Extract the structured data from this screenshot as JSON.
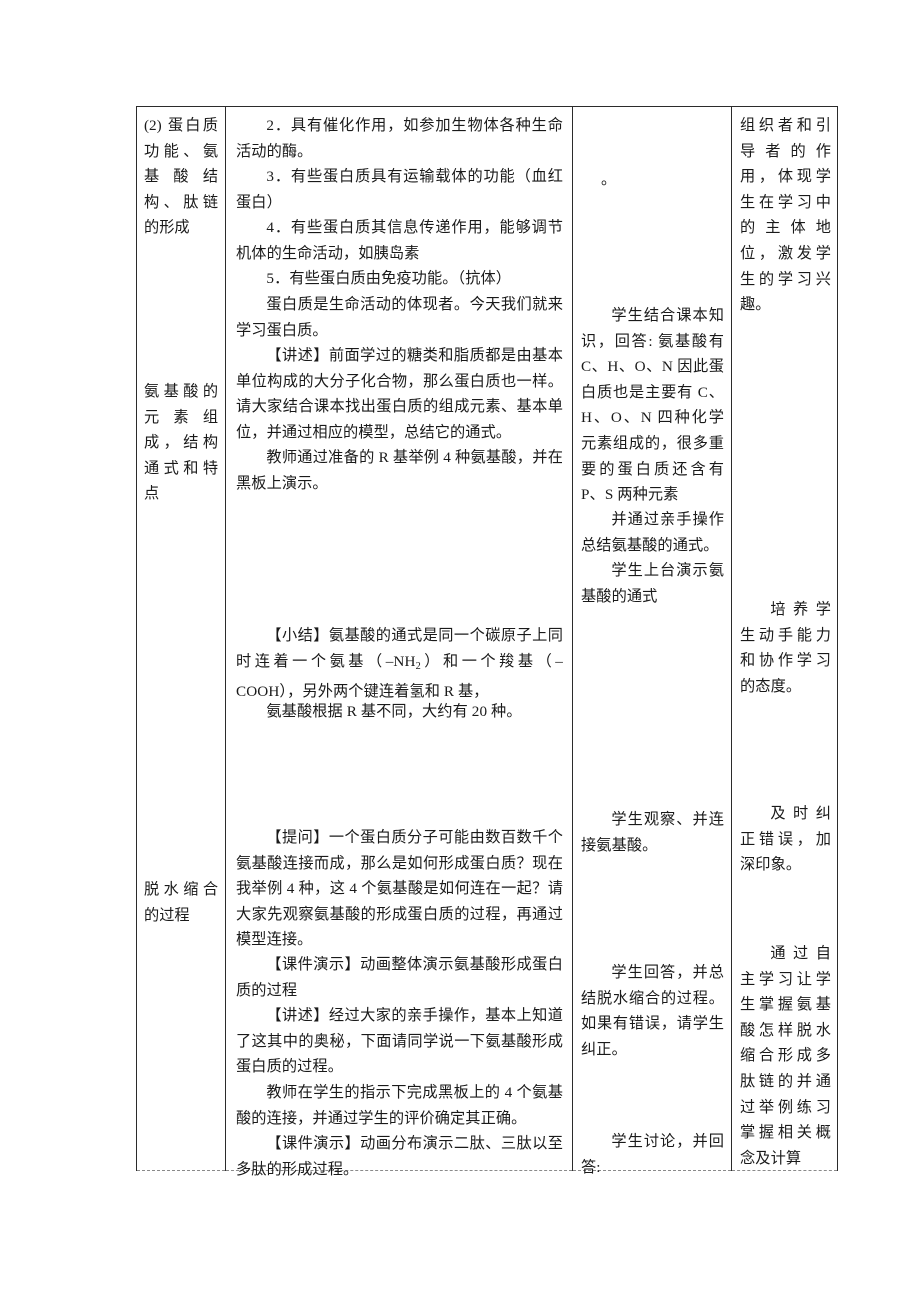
{
  "document": {
    "type": "lesson-plan-table",
    "page_background": "#ffffff",
    "border_color": "#2b2b2b",
    "bottom_border_style": "dashed"
  },
  "columns": [
    {
      "key": "stage",
      "name": "teaching-stage-column"
    },
    {
      "key": "teacher",
      "name": "teacher-activity-column"
    },
    {
      "key": "student",
      "name": "student-activity-column"
    },
    {
      "key": "intent",
      "name": "design-intent-column"
    }
  ],
  "stage_column": {
    "items": [
      {
        "id": "stage-1",
        "text": "(2) 蛋白质功能、氨基酸结构、肽链的形成"
      },
      {
        "id": "stage-2",
        "text": "氨基酸的元素组成，结构通式和特点"
      },
      {
        "id": "stage-3",
        "text": "脱水缩合的过程"
      }
    ]
  },
  "teacher_column": {
    "blocks": [
      {
        "id": "t-1",
        "text": "2．具有催化作用，如参加生物体各种生命活动的酶。"
      },
      {
        "id": "t-2",
        "text": "3．有些蛋白质具有运输载体的功能（血红蛋白）"
      },
      {
        "id": "t-3",
        "text": "4．有些蛋白质其信息传递作用，能够调节机体的生命活动，如胰岛素"
      },
      {
        "id": "t-4",
        "text": "5．有些蛋白质由免疫功能。（抗体）"
      },
      {
        "id": "t-5",
        "text": "蛋白质是生命活动的体现者。今天我们就来学习蛋白质。"
      },
      {
        "id": "t-6",
        "text": "【讲述】前面学过的糖类和脂质都是由基本单位构成的大分子化合物，那么蛋白质也一样。请大家结合课本找出蛋白质的组成元素、基本单位，并通过相应的模型，总结它的通式。"
      },
      {
        "id": "t-7",
        "text": "教师通过准备的 R 基举例 4 种氨基酸，并在黑板上演示。"
      },
      {
        "id": "t-8-part1",
        "text": "【小结】氨基酸的通式是同一个碳原子上同时连着一个氨基（–NH"
      },
      {
        "id": "t-8-sub",
        "text": "2"
      },
      {
        "id": "t-8-part2",
        "text": "）和一个羧基（–COOH），另外两个键连着氢和 R 基，"
      },
      {
        "id": "t-9",
        "text": "氨基酸根据 R 基不同，大约有 20 种。"
      },
      {
        "id": "t-10",
        "text": "【提问】一个蛋白质分子可能由数百数千个氨基酸连接而成，那么是如何形成蛋白质？现在我举例 4 种，这 4 个氨基酸是如何连在一起？请大家先观察氨基酸的形成蛋白质的过程，再通过模型连接。"
      },
      {
        "id": "t-11",
        "text": "【课件演示】动画整体演示氨基酸形成蛋白质的过程"
      },
      {
        "id": "t-12",
        "text": "【讲述】经过大家的亲手操作，基本上知道了这其中的奥秘，下面请同学说一下氨基酸形成蛋白质的过程。"
      },
      {
        "id": "t-13",
        "text": "教师在学生的指示下完成黑板上的 4 个氨基酸的连接，并通过学生的评价确定其正确。"
      },
      {
        "id": "t-14",
        "text": "【课件演示】动画分布演示二肽、三肽以至多肽的形成过程。"
      }
    ]
  },
  "student_column": {
    "blocks": [
      {
        "id": "s-0",
        "text": "。"
      },
      {
        "id": "s-1",
        "text": "学生结合课本知识，回答: 氨基酸有 C、H、O、N 因此蛋白质也是主要有 C、H、O、N 四种化学元素组成的，很多重要的蛋白质还含有 P、S 两种元素"
      },
      {
        "id": "s-2",
        "text": "并通过亲手操作总结氨基酸的通式。"
      },
      {
        "id": "s-3",
        "text": "学生上台演示氨基酸的通式"
      },
      {
        "id": "s-4",
        "text": "学生观察、并连接氨基酸。"
      },
      {
        "id": "s-5",
        "text": "学生回答，并总结脱水缩合的过程。如果有错误，请学生纠正。"
      },
      {
        "id": "s-6",
        "text": "学生讨论，并回答:"
      }
    ]
  },
  "intent_column": {
    "blocks": [
      {
        "id": "i-1",
        "text": "组织者和引导者的作用，体现学生在学习中的主体地位，激发学生的学习兴趣。"
      },
      {
        "id": "i-2",
        "text": "培养学生动手能力和协作学习的态度。"
      },
      {
        "id": "i-3",
        "text": "及时纠正错误，加深印象。"
      },
      {
        "id": "i-4",
        "text": "通过自主学习让学生掌握氨基酸怎样脱水缩合形成多肽链的并通过举例练习掌握相关概念及计算"
      }
    ]
  }
}
